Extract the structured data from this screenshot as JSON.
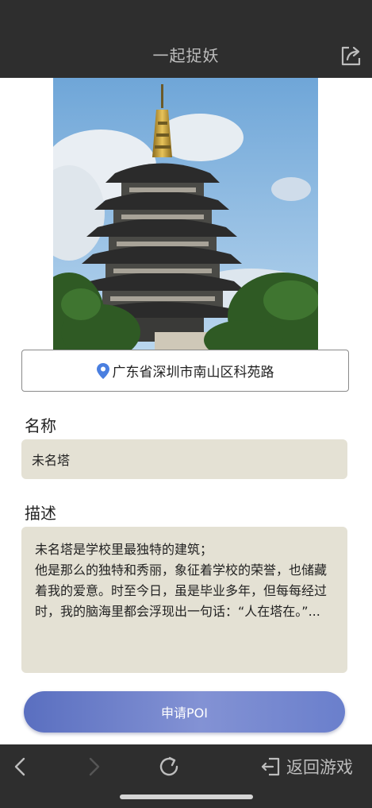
{
  "header": {
    "title": "一起捉妖",
    "share_icon": "share-export-icon"
  },
  "photo": {
    "subject": "pagoda-photo"
  },
  "location": {
    "icon": "map-pin-icon",
    "icon_color": "#4a7fe0",
    "address": "广东省深圳市南山区科苑路"
  },
  "form": {
    "name_label": "名称",
    "name_value": "未名塔",
    "description_label": "描述",
    "description_lines": [
      "未名塔是学校里最独特的建筑；",
      "他是那么的独特和秀丽，象征着学校的荣誉，也储藏着我的爱意。时至今日，虽是毕业多年，但每每经过时，我的脑海里都会浮现出一句话：“人在塔在。”..."
    ],
    "input_bg": "#e4e1d4"
  },
  "actions": {
    "apply_label": "申请POI",
    "apply_color": "#6f80cc"
  },
  "bottom_bar": {
    "back_icon": "chevron-left-icon",
    "forward_icon": "chevron-right-icon",
    "reload_icon": "reload-icon",
    "return_icon": "exit-door-icon",
    "return_label": "返回游戏"
  },
  "colors": {
    "bar_bg": "#2e2e2e",
    "bar_text": "#bdbdbd"
  }
}
